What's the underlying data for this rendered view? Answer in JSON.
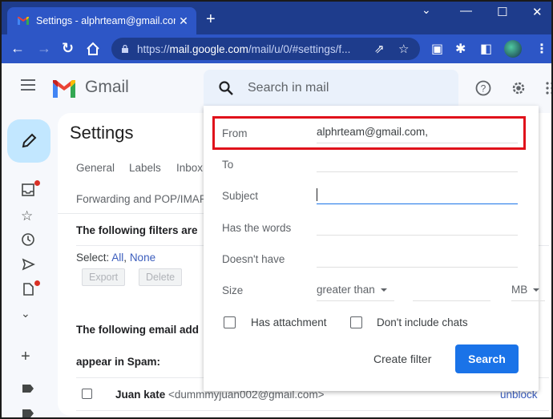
{
  "browser": {
    "tab_title": "Settings - alphrteam@gmail.com",
    "url_prefix": "https://",
    "url_host": "mail.google.com",
    "url_path": "/mail/u/0/#settings/f...",
    "new_tab_label": "+",
    "tab_close_label": "✕"
  },
  "header": {
    "app_name": "Gmail",
    "search_placeholder": "Search in mail"
  },
  "settings": {
    "title": "Settings",
    "tabs": [
      "General",
      "Labels",
      "Inbox"
    ],
    "tab_row2": "Forwarding and POP/IMAP",
    "filters_heading": "The following filters are",
    "select_label": "Select: ",
    "select_all": "All",
    "select_sep": ", ",
    "select_none": "None",
    "export_label": "Export",
    "delete_label": "Delete",
    "blocked_heading_line1": "The following email add",
    "blocked_heading_line2": "appear in Spam:",
    "blocked_rows": [
      {
        "name": "Juan kate",
        "email": " <dummmyjuan002@gmail.com>",
        "action": "unblock"
      }
    ]
  },
  "search_panel": {
    "fields": [
      {
        "label": "From",
        "value": "alphrteam@gmail.com,"
      },
      {
        "label": "To",
        "value": ""
      },
      {
        "label": "Subject",
        "value": ""
      },
      {
        "label": "Has the words",
        "value": ""
      },
      {
        "label": "Doesn't have",
        "value": ""
      }
    ],
    "size_label": "Size",
    "size_operator": "greater than",
    "size_value": "",
    "size_unit": "MB",
    "has_attachment_label": "Has attachment",
    "has_attachment_checked": false,
    "exclude_chats_label": "Don't include chats",
    "exclude_chats_checked": false,
    "create_filter_label": "Create filter",
    "search_button_label": "Search"
  },
  "colors": {
    "accent": "#1a73e8",
    "highlight_border": "#e0121b",
    "chrome_frame": "#1e3c8c",
    "chrome_toolbar": "#2d56c6",
    "compose_bg": "#c2e7ff",
    "notification_dot": "#d93025"
  }
}
